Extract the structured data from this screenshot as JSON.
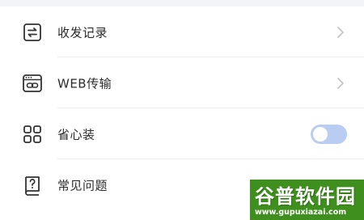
{
  "menu": {
    "items": [
      {
        "label": "收发记录",
        "icon": "transfer-record-icon",
        "control": "chevron"
      },
      {
        "label": "WEB传输",
        "icon": "web-transfer-icon",
        "control": "chevron"
      },
      {
        "label": "省心装",
        "icon": "grid-apps-icon",
        "control": "toggle",
        "toggle_on": false
      },
      {
        "label": "常见问题",
        "icon": "help-book-icon",
        "control": "none"
      }
    ]
  },
  "watermark": {
    "title": "谷普软件园",
    "url": "www.gupuxiazai.com"
  },
  "colors": {
    "text": "#2b2b2b",
    "icon": "#333333",
    "chevron": "#c2c2c2",
    "toggle_track": "#b9cdf2",
    "watermark_bg": "#3f8f1f"
  }
}
